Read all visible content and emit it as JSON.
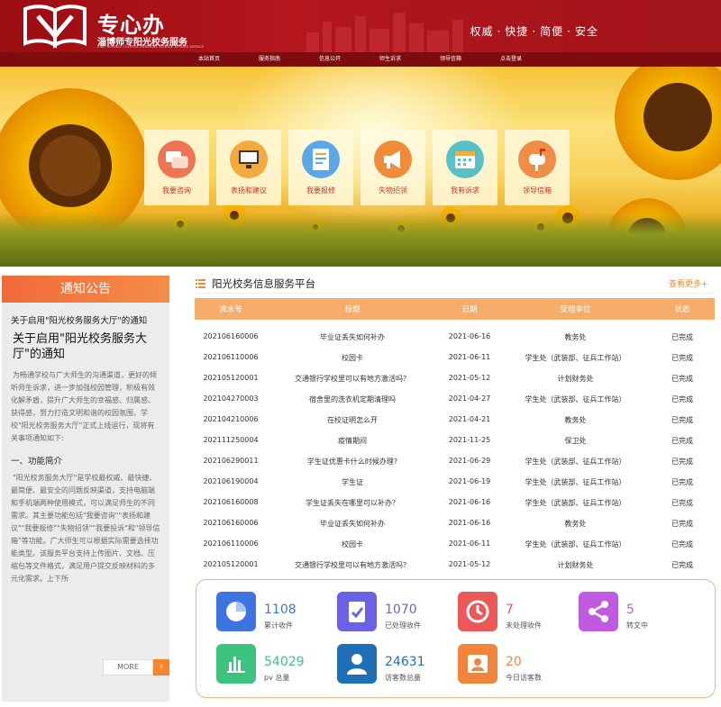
{
  "header": {
    "logo_cn": "专心办",
    "logo_sub": "淄博师专阳光校务服务",
    "logo_en": "ZIBO NORMAL COLLEGE SUNSHINE SCHOOL AFFAIRS SERVICE",
    "slogan": [
      "权威",
      "快捷",
      "简便",
      "安全"
    ]
  },
  "nav": [
    "本站首页",
    "服务指南",
    "信息公开",
    "师生诉求",
    "领导信箱",
    "点击登录"
  ],
  "tiles": [
    {
      "label": "我要咨询",
      "icon": "chat-bubbles-icon",
      "color": "#ee7452"
    },
    {
      "label": "表扬和建议",
      "icon": "monitor-icon",
      "color": "#f2ab3c"
    },
    {
      "label": "我要报修",
      "icon": "document-icon",
      "color": "#5ba8e8"
    },
    {
      "label": "失物招领",
      "icon": "megaphone-icon",
      "color": "#f08b3a"
    },
    {
      "label": "我有诉求",
      "icon": "calendar-icon",
      "color": "#58c1c6"
    },
    {
      "label": "领导信箱",
      "icon": "mailbox-icon",
      "color": "#f08c46"
    }
  ],
  "notice": {
    "header": "通知公告",
    "item_title": "关于启用\"阳光校务服务大厅\"的通知",
    "article_title": "关于启用\"阳光校务服务大厅\"的通知",
    "paragraph1": "为畅通学校与广大师生的沟通渠道，更好的倾听师生诉求，进一步加强校园管理，积极有效化解矛盾，提升广大师生的幸福感、归属感、获得感，努力打造文明和谐的校园氛围，学校\"阳光校务服务大厅\"正式上线运行，现将有关事项通知如下:",
    "section": "一、功能简介",
    "paragraph2": "\"阳光校务服务大厅\"是学校最权威、最快捷、最简便、最安全的问题反映渠道，支持电脑端和手机端两种使用模式，可以满足师生的不同需求。其主要功能包括\"我要咨询\"\"表扬和建议\"\"我要报修\"\"失物招领\"\"我要投诉\"和\"领导信箱\"等功能。广大师生可以根据实际需要选择功能类型。该服务平台支持上传图片、文档、压缩包等文件格式，满足用户提交反映材料的多元化需求。上下所",
    "more": "MORE"
  },
  "platform": {
    "title": "阳光校务信息服务平台",
    "more": "查看更多+",
    "columns": [
      "流水号",
      "标题",
      "日期",
      "受理单位",
      "状态"
    ],
    "rows": [
      [
        "202106160006",
        "毕业证丢失如何补办",
        "2021-06-16",
        "教务处",
        "已完成"
      ],
      [
        "202106110006",
        "校园卡",
        "2021-06-11",
        "学生处（武装部、征兵工作站）",
        "已完成"
      ],
      [
        "202105120001",
        "交通银行学校里可以有地方激活吗？",
        "2021-05-12",
        "计划财务处",
        "已完成"
      ],
      [
        "202104270003",
        "宿舍里的洗衣机定期清理吗",
        "2021-04-27",
        "学生处（武装部、征兵工作站）",
        "已完成"
      ],
      [
        "202104210006",
        "在校证明怎么开",
        "2021-04-21",
        "教务处",
        "已完成"
      ],
      [
        "202111250004",
        "疫情期间",
        "2021-11-25",
        "保卫处",
        "已完成"
      ],
      [
        "202106290011",
        "学生证优惠卡什么时候办理?",
        "2021-06-29",
        "学生处（武装部、征兵工作站）",
        "已完成"
      ],
      [
        "202106190004",
        "学生证",
        "2021-06-19",
        "学生处（武装部、征兵工作站）",
        "已完成"
      ],
      [
        "202106160008",
        "学生证丢失在哪里可以补办？",
        "2021-06-16",
        "学生处（武装部、征兵工作站）",
        "已完成"
      ],
      [
        "202106160006",
        "毕业证丢失如何补办",
        "2021-06-16",
        "教务处",
        "已完成"
      ],
      [
        "202106110006",
        "校园卡",
        "2021-06-11",
        "学生处（武装部、征兵工作站）",
        "已完成"
      ],
      [
        "202105120001",
        "交通银行学校里可以有地方激活吗？",
        "2021-05-12",
        "计划财务处",
        "已完成"
      ]
    ]
  },
  "stats": [
    {
      "value": "1108",
      "label": "累计收件",
      "icon": "pie-chart-icon",
      "color": "#3c74e0",
      "text_color": "#3c74e0"
    },
    {
      "value": "1070",
      "label": "已处理收件",
      "icon": "clipboard-check-icon",
      "color": "#6a61e6",
      "text_color": "#6a61e6"
    },
    {
      "value": "7",
      "label": "未处理收件",
      "icon": "clock-icon",
      "color": "#ec5757",
      "text_color": "#ec5757"
    },
    {
      "value": "5",
      "label": "转文中",
      "icon": "share-icon",
      "color": "#c259e1",
      "text_color": "#c259e1"
    },
    {
      "value": "54029",
      "label": "pv 总量",
      "icon": "bar-chart-icon",
      "color": "#3cc47e",
      "text_color": "#3cc47e"
    },
    {
      "value": "24631",
      "label": "访客数总量",
      "icon": "person-icon",
      "color": "#1f6fb6",
      "text_color": "#1f6fb6"
    },
    {
      "value": "20",
      "label": "今日访客数",
      "icon": "visitor-card-icon",
      "color": "#f2843c",
      "text_color": "#f2843c"
    }
  ]
}
